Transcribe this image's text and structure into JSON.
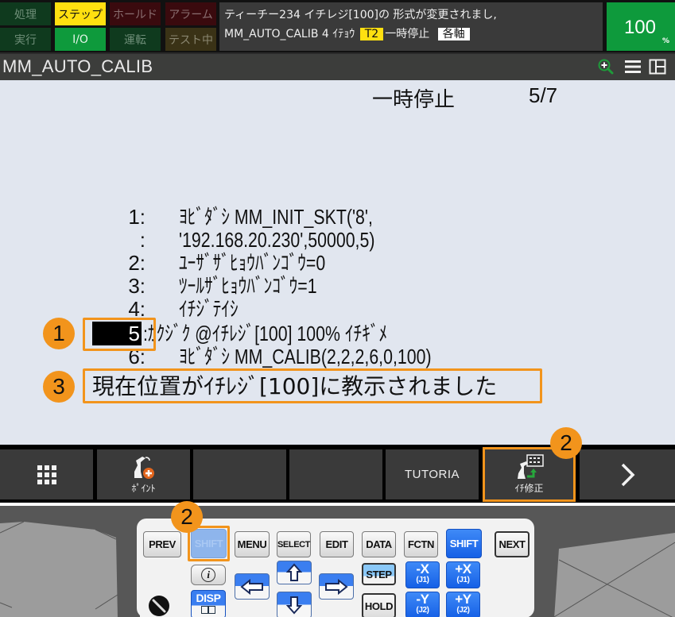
{
  "status_lamps": [
    {
      "label": "処理",
      "state": "off",
      "color": "green"
    },
    {
      "label": "ステップ",
      "state": "on",
      "color": "yellow"
    },
    {
      "label": "ホールド",
      "state": "off",
      "color": "red"
    },
    {
      "label": "アラーム",
      "state": "off",
      "color": "red"
    },
    {
      "label": "実行",
      "state": "off",
      "color": "green"
    },
    {
      "label": "I/O",
      "state": "on",
      "color": "green"
    },
    {
      "label": "運転",
      "state": "off",
      "color": "green"
    },
    {
      "label": "テスト中",
      "state": "off",
      "color": "brown"
    }
  ],
  "message": {
    "line1": "ティーチー234 イチレジ[100]の 形式が変更されまし,",
    "program": "MM_AUTO_CALIB",
    "line_no": "4",
    "line_label": "ｲﾃｮｳ",
    "mode_badge": "T2",
    "status": "一時停止",
    "coord_badge": "各軸"
  },
  "override": {
    "value": "100",
    "unit": "%"
  },
  "title_bar": {
    "title": "MM_AUTO_CALIB",
    "icons": [
      "zoom-in-icon",
      "menu-icon",
      "split-view-icon"
    ]
  },
  "editor": {
    "status": "一時停止",
    "position": "5/7",
    "lines": [
      {
        "num": "1:",
        "code": "ﾖﾋﾞﾀﾞｼ MM_INIT_SKT('8',"
      },
      {
        "num": ":",
        "code": "'192.168.20.230',50000,5)"
      },
      {
        "num": "2:",
        "code": "ﾕｰｻﾞｻﾞﾋｮｳﾊﾞﾝｺﾞｳ=0"
      },
      {
        "num": "3:",
        "code": "ﾂｰﾙｻﾞﾋｮｳﾊﾞﾝｺﾞｳ=1"
      },
      {
        "num": "4:",
        "code": "ｲﾁｼﾞﾃｲｼ"
      },
      {
        "num": "5",
        "code": ":ｶｸｼﾞｸ @ｲﾁﾚｼﾞ[100] 100% ｲﾁｷﾞﾒ",
        "cursor": true
      },
      {
        "num": "6:",
        "code": "ﾖﾋﾞﾀﾞｼ MM_CALIB(2,2,2,6,0,100)"
      }
    ],
    "message": "現在位置がｲﾁﾚｼﾞ[100]に教示されました"
  },
  "annotations": [
    "1",
    "2",
    "3",
    "2"
  ],
  "function_keys": [
    {
      "id": "menu-grid",
      "label": "",
      "icon": "grid-icon"
    },
    {
      "id": "point",
      "label": "ﾎﾟｲﾝﾄ",
      "icon": "robot-add-icon"
    },
    {
      "id": "empty-3",
      "label": ""
    },
    {
      "id": "empty-4",
      "label": ""
    },
    {
      "id": "tutoria",
      "label": "TUTORIA"
    },
    {
      "id": "touchup",
      "label": "ｲﾁ修正",
      "icon": "robot-touchup-icon",
      "highlighted": true
    },
    {
      "id": "next-page",
      "label": "",
      "icon": "chevron-right-icon"
    }
  ],
  "pendant_keys": {
    "prev": "PREV",
    "shift_left": "SHIFT",
    "menu": "MENU",
    "select": "SELECT",
    "edit": "EDIT",
    "data": "DATA",
    "fctn": "FCTN",
    "shift_right": "SHIFT",
    "next": "NEXT",
    "info": "i",
    "disp": "DISP",
    "step": "STEP",
    "hold": "HOLD",
    "jog": [
      {
        "axis": "-X",
        "joint": "(J1)"
      },
      {
        "axis": "+X",
        "joint": "(J1)"
      },
      {
        "axis": "-Y",
        "joint": "(J2)"
      },
      {
        "axis": "+Y",
        "joint": "(J2)"
      }
    ]
  },
  "colors": {
    "annotation": "#f2941c",
    "editor_bg": "#e1e6ef",
    "override_bg": "#0e9a3c",
    "step_on": "#ffe010"
  }
}
